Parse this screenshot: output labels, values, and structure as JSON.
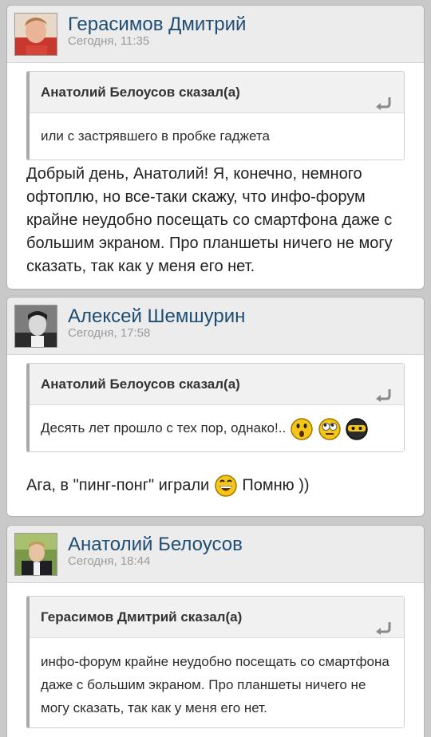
{
  "posts": [
    {
      "author": "Герасимов Дмитрий",
      "time": "Сегодня, 11:35",
      "quote": {
        "header": "Анатолий Белоусов сказал(а)",
        "text": "или с застрявшего в пробке гаджета"
      },
      "text": "Добрый день, Анатолий! Я, конечно, немного офтоплю, но все-таки скажу, что инфо-форум крайне неудобно посещать со смартфона даже с большим экраном. Про планшеты ничего не могу сказать, так как у меня его нет."
    },
    {
      "author": "Алексей Шемшурин",
      "time": "Сегодня, 17:58",
      "quote": {
        "header": "Анатолий Белоусов сказал(а)",
        "text": "Десять лет прошло с тех пор, однако!..",
        "smileys": [
          "surprised-smiley-icon",
          "rolling-eyes-smiley-icon",
          "ninja-smiley-icon"
        ]
      },
      "text_before": "Ага, в \"пинг-понг\" играли",
      "text_after": "Помню ))",
      "smiley": "big-grin-smiley-icon"
    },
    {
      "author": "Анатолий Белоусов",
      "time": "Сегодня, 18:44",
      "quote": {
        "header": "Герасимов Дмитрий сказал(а)",
        "text": "инфо-форум крайне неудобно посещать со смартфона даже с большим экраном. Про планшеты ничего не могу сказать, так как у меня его нет."
      }
    }
  ],
  "colors": {
    "author": "#1f4d73",
    "time": "#9a9a9a",
    "header_bg": "#ececec",
    "page_bg": "#c9c9c9",
    "smiley_yellow": "#f5c518"
  }
}
